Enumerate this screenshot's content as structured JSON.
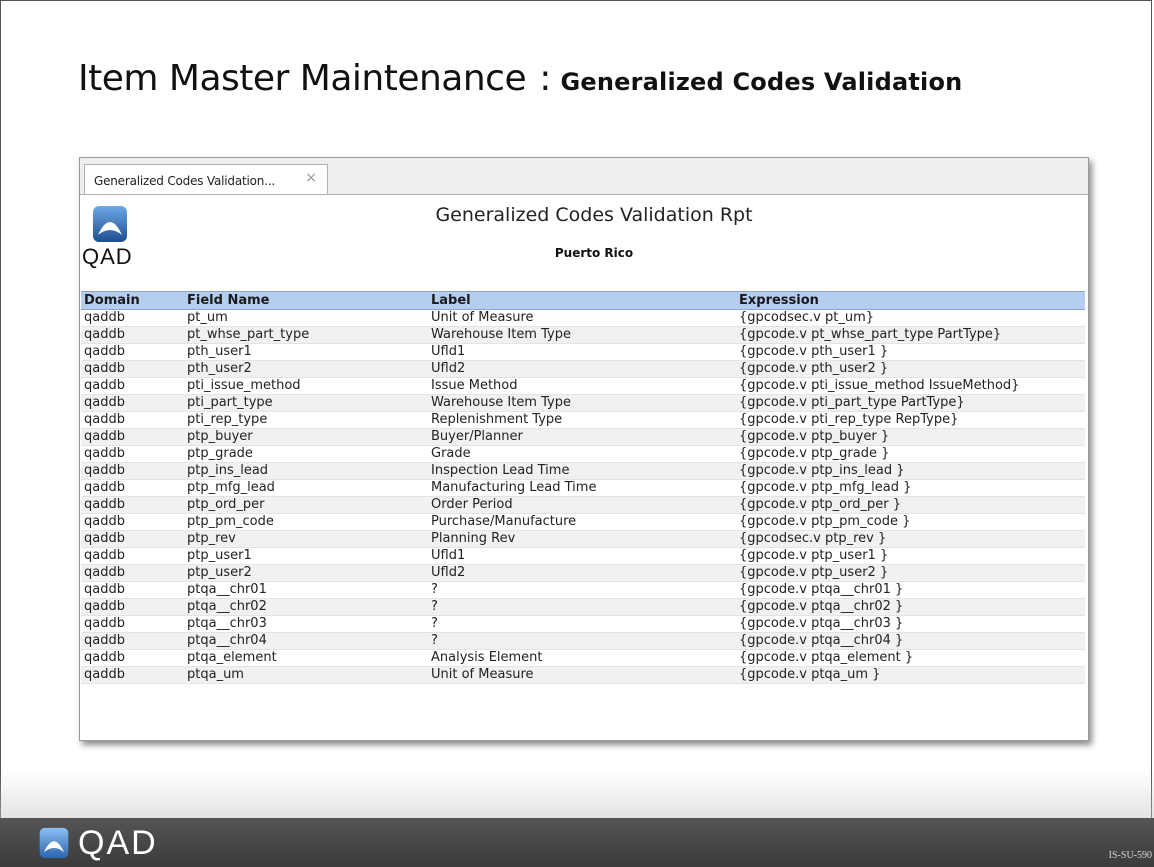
{
  "slide": {
    "title_main": "Item Master Maintenance",
    "title_separator": ":",
    "title_sub": "Generalized Codes Validation",
    "code": "IS-SU-590"
  },
  "window": {
    "tab_label": "Generalized Codes Validation...",
    "tab_close": "×"
  },
  "report": {
    "logo_text": "QAD",
    "title": "Generalized Codes Validation Rpt",
    "subtitle": "Puerto Rico"
  },
  "table": {
    "headers": [
      "Domain",
      "Field Name",
      "Label",
      "Expression"
    ],
    "rows": [
      [
        "qaddb",
        "pt_um",
        "Unit of Measure",
        "{gpcodsec.v pt_um}"
      ],
      [
        "qaddb",
        "pt_whse_part_type",
        "Warehouse Item Type",
        "{gpcode.v pt_whse_part_type PartType}"
      ],
      [
        "qaddb",
        "pth_user1",
        "Ufld1",
        "{gpcode.v pth_user1 }"
      ],
      [
        "qaddb",
        "pth_user2",
        "Ufld2",
        "{gpcode.v pth_user2 }"
      ],
      [
        "qaddb",
        "pti_issue_method",
        "Issue Method",
        "{gpcode.v pti_issue_method IssueMethod}"
      ],
      [
        "qaddb",
        "pti_part_type",
        "Warehouse Item Type",
        "{gpcode.v pti_part_type PartType}"
      ],
      [
        "qaddb",
        "pti_rep_type",
        "Replenishment Type",
        "{gpcode.v pti_rep_type RepType}"
      ],
      [
        "qaddb",
        "ptp_buyer",
        "Buyer/Planner",
        "{gpcode.v ptp_buyer }"
      ],
      [
        "qaddb",
        "ptp_grade",
        "Grade",
        "{gpcode.v ptp_grade }"
      ],
      [
        "qaddb",
        "ptp_ins_lead",
        "Inspection Lead Time",
        "{gpcode.v ptp_ins_lead }"
      ],
      [
        "qaddb",
        "ptp_mfg_lead",
        "Manufacturing Lead Time",
        "{gpcode.v ptp_mfg_lead }"
      ],
      [
        "qaddb",
        "ptp_ord_per",
        "Order Period",
        "{gpcode.v ptp_ord_per }"
      ],
      [
        "qaddb",
        "ptp_pm_code",
        "Purchase/Manufacture",
        "{gpcode.v ptp_pm_code }"
      ],
      [
        "qaddb",
        "ptp_rev",
        "Planning Rev",
        "{gpcodsec.v ptp_rev }"
      ],
      [
        "qaddb",
        "ptp_user1",
        "Ufld1",
        "{gpcode.v ptp_user1 }"
      ],
      [
        "qaddb",
        "ptp_user2",
        "Ufld2",
        "{gpcode.v ptp_user2 }"
      ],
      [
        "qaddb",
        "ptqa__chr01",
        "?",
        "{gpcode.v ptqa__chr01 }"
      ],
      [
        "qaddb",
        "ptqa__chr02",
        "?",
        "{gpcode.v ptqa__chr02 }"
      ],
      [
        "qaddb",
        "ptqa__chr03",
        "?",
        "{gpcode.v ptqa__chr03 }"
      ],
      [
        "qaddb",
        "ptqa__chr04",
        "?",
        "{gpcode.v ptqa__chr04 }"
      ],
      [
        "qaddb",
        "ptqa_element",
        "Analysis Element",
        "{gpcode.v ptqa_element }"
      ],
      [
        "qaddb",
        "ptqa_um",
        "Unit of Measure",
        "{gpcode.v ptqa_um }"
      ]
    ]
  },
  "footer": {
    "logo_text": "QAD"
  },
  "colors": {
    "header_row_bg": "#b5cdef",
    "footer_bg": "#3b3b3b",
    "logo_blue": "#2f6fb3"
  },
  "icons": {
    "logo": "qad-logo-icon",
    "tab_close": "close-icon"
  }
}
